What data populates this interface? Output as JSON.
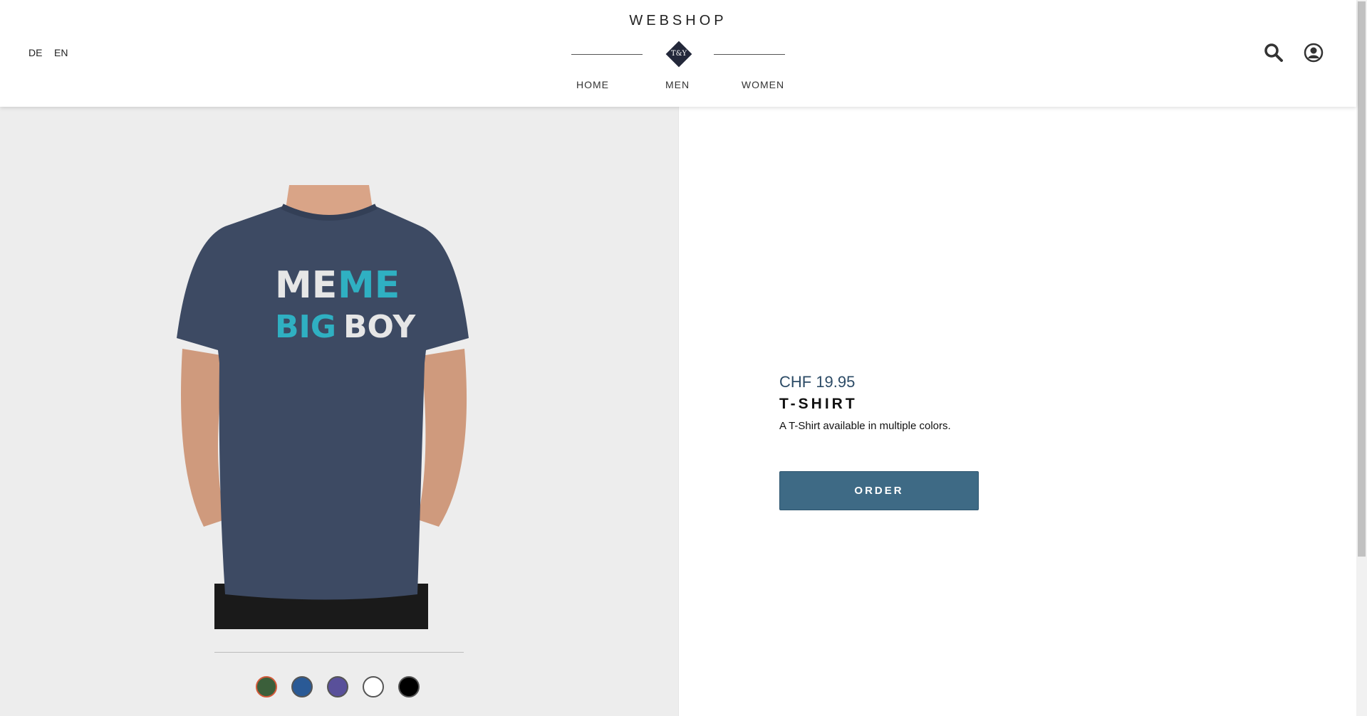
{
  "header": {
    "brand": "WEBSHOP",
    "logo_text": "T&Y",
    "languages": [
      "DE",
      "EN"
    ],
    "nav": [
      "HOME",
      "MEN",
      "WOMEN"
    ],
    "icons": [
      "search-icon",
      "user-account-icon"
    ]
  },
  "product": {
    "image_print": {
      "line1_a": "ME",
      "line1_b": "ME",
      "line2_a": "BIG",
      "line2_b": "BOY"
    },
    "price": "CHF 19.95",
    "name": "T-SHIRT",
    "description": "A T-Shirt available in multiple colors.",
    "order_label": "ORDER",
    "color_swatches": [
      {
        "name": "green",
        "color": "#3b5f3a",
        "selected": true
      },
      {
        "name": "blue",
        "color": "#2a5a96",
        "selected": false
      },
      {
        "name": "purple",
        "color": "#59509a",
        "selected": false
      },
      {
        "name": "white",
        "color": "#ffffff",
        "selected": false
      },
      {
        "name": "black",
        "color": "#000000",
        "selected": false
      }
    ]
  },
  "colors": {
    "accent": "#3e6a85",
    "price": "#2c4b66",
    "shirt": "#3d4a63",
    "print_teal": "#2fb0c2",
    "print_light": "#e6e6e6"
  }
}
